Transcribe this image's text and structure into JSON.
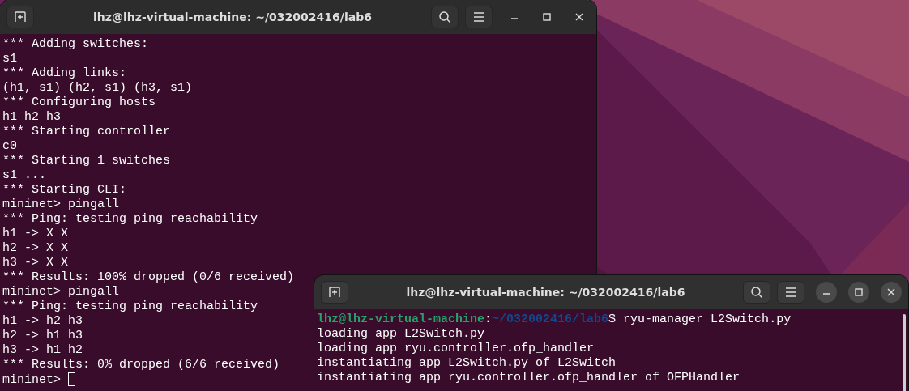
{
  "windows": [
    {
      "title": "lhz@lhz-virtual-machine: ~/032002416/lab6",
      "focused": false,
      "cursor": true,
      "lines": [
        [
          {
            "kind": "plain",
            "text": "*** Adding switches:"
          }
        ],
        [
          {
            "kind": "plain",
            "text": "s1"
          }
        ],
        [
          {
            "kind": "plain",
            "text": "*** Adding links:"
          }
        ],
        [
          {
            "kind": "plain",
            "text": "(h1, s1) (h2, s1) (h3, s1)"
          }
        ],
        [
          {
            "kind": "plain",
            "text": "*** Configuring hosts"
          }
        ],
        [
          {
            "kind": "plain",
            "text": "h1 h2 h3"
          }
        ],
        [
          {
            "kind": "plain",
            "text": "*** Starting controller"
          }
        ],
        [
          {
            "kind": "plain",
            "text": "c0"
          }
        ],
        [
          {
            "kind": "plain",
            "text": "*** Starting 1 switches"
          }
        ],
        [
          {
            "kind": "plain",
            "text": "s1 ..."
          }
        ],
        [
          {
            "kind": "plain",
            "text": "*** Starting CLI:"
          }
        ],
        [
          {
            "kind": "plain",
            "text": "mininet> pingall"
          }
        ],
        [
          {
            "kind": "plain",
            "text": "*** Ping: testing ping reachability"
          }
        ],
        [
          {
            "kind": "plain",
            "text": "h1 -> X X"
          }
        ],
        [
          {
            "kind": "plain",
            "text": "h2 -> X X"
          }
        ],
        [
          {
            "kind": "plain",
            "text": "h3 -> X X"
          }
        ],
        [
          {
            "kind": "plain",
            "text": "*** Results: 100% dropped (0/6 received)"
          }
        ],
        [
          {
            "kind": "plain",
            "text": "mininet> pingall"
          }
        ],
        [
          {
            "kind": "plain",
            "text": "*** Ping: testing ping reachability"
          }
        ],
        [
          {
            "kind": "plain",
            "text": "h1 -> h2 h3"
          }
        ],
        [
          {
            "kind": "plain",
            "text": "h2 -> h1 h3"
          }
        ],
        [
          {
            "kind": "plain",
            "text": "h3 -> h1 h2"
          }
        ],
        [
          {
            "kind": "plain",
            "text": "*** Results: 0% dropped (6/6 received)"
          }
        ],
        [
          {
            "kind": "plain",
            "text": "mininet>"
          }
        ]
      ]
    },
    {
      "title": "lhz@lhz-virtual-machine: ~/032002416/lab6",
      "focused": true,
      "cursor": false,
      "lines": [
        [
          {
            "kind": "user",
            "text": "lhz@lhz-virtual-machine"
          },
          {
            "kind": "plain",
            "text": ":"
          },
          {
            "kind": "path",
            "text": "~/032002416/lab6"
          },
          {
            "kind": "plain",
            "text": "$ ryu-manager L2Switch.py"
          }
        ],
        [
          {
            "kind": "plain",
            "text": "loading app L2Switch.py"
          }
        ],
        [
          {
            "kind": "plain",
            "text": "loading app ryu.controller.ofp_handler"
          }
        ],
        [
          {
            "kind": "plain",
            "text": "instantiating app L2Switch.py of L2Switch"
          }
        ],
        [
          {
            "kind": "plain",
            "text": "instantiating app ryu.controller.ofp_handler of OFPHandler"
          }
        ]
      ]
    }
  ]
}
